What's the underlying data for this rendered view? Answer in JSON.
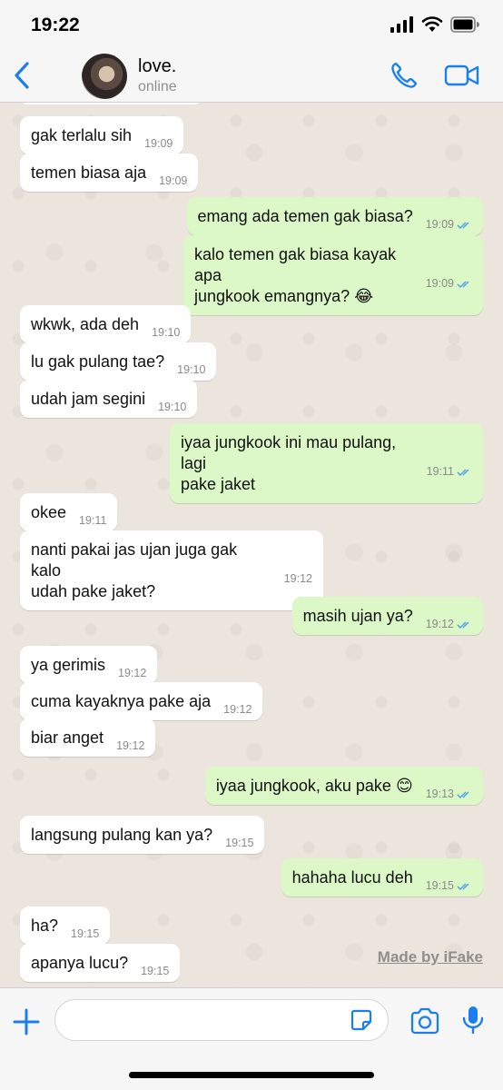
{
  "status_bar": {
    "time": "19:22"
  },
  "header": {
    "contact_name": "love.",
    "contact_status": "online"
  },
  "colors": {
    "accent": "#1a7ef2",
    "incoming_bubble": "#ffffff",
    "outgoing_bubble": "#dcf8c6",
    "read_ticks": "#4fa3e6"
  },
  "messages": [
    {
      "dir": "in",
      "text": "gak terlalu sih",
      "time": "19:09"
    },
    {
      "dir": "in",
      "text": "temen biasa aja",
      "time": "19:09"
    },
    {
      "dir": "out",
      "text": "emang ada temen gak biasa?",
      "time": "19:09",
      "status": "read"
    },
    {
      "dir": "out",
      "text": "kalo temen gak biasa kayak apa\njungkook emangnya? 😂",
      "time": "19:09",
      "status": "read"
    },
    {
      "dir": "in",
      "text": "wkwk, ada deh",
      "time": "19:10"
    },
    {
      "dir": "in",
      "text": "lu gak pulang tae?",
      "time": "19:10"
    },
    {
      "dir": "in",
      "text": "udah jam segini",
      "time": "19:10"
    },
    {
      "dir": "out",
      "text": "iyaa jungkook ini mau pulang, lagi\npake jaket",
      "time": "19:11",
      "status": "read"
    },
    {
      "dir": "in",
      "text": "okee",
      "time": "19:11"
    },
    {
      "dir": "in",
      "text": "nanti pakai jas ujan juga gak kalo\nudah pake jaket?",
      "time": "19:12"
    },
    {
      "dir": "out",
      "text": "masih ujan ya?",
      "time": "19:12",
      "status": "read"
    },
    {
      "dir": "in",
      "text": "ya gerimis",
      "time": "19:12"
    },
    {
      "dir": "in",
      "text": "cuma kayaknya pake aja",
      "time": "19:12"
    },
    {
      "dir": "in",
      "text": "biar anget",
      "time": "19:12"
    },
    {
      "dir": "out",
      "text": "iyaa jungkook, aku pake 😊",
      "time": "19:13",
      "status": "read"
    },
    {
      "dir": "in",
      "text": "langsung pulang kan ya?",
      "time": "19:15"
    },
    {
      "dir": "out",
      "text": "hahaha lucu deh",
      "time": "19:15",
      "status": "read"
    },
    {
      "dir": "in",
      "text": "ha?",
      "time": "19:15"
    },
    {
      "dir": "in",
      "text": "apanya lucu?",
      "time": "19:15"
    }
  ],
  "watermark": "Made by iFake",
  "input": {
    "placeholder": ""
  },
  "icons": {
    "back": "chevron-left-icon",
    "call": "phone-icon",
    "video": "video-camera-icon",
    "add": "plus-icon",
    "sticker": "sticker-icon",
    "camera": "camera-icon",
    "mic": "microphone-icon"
  }
}
